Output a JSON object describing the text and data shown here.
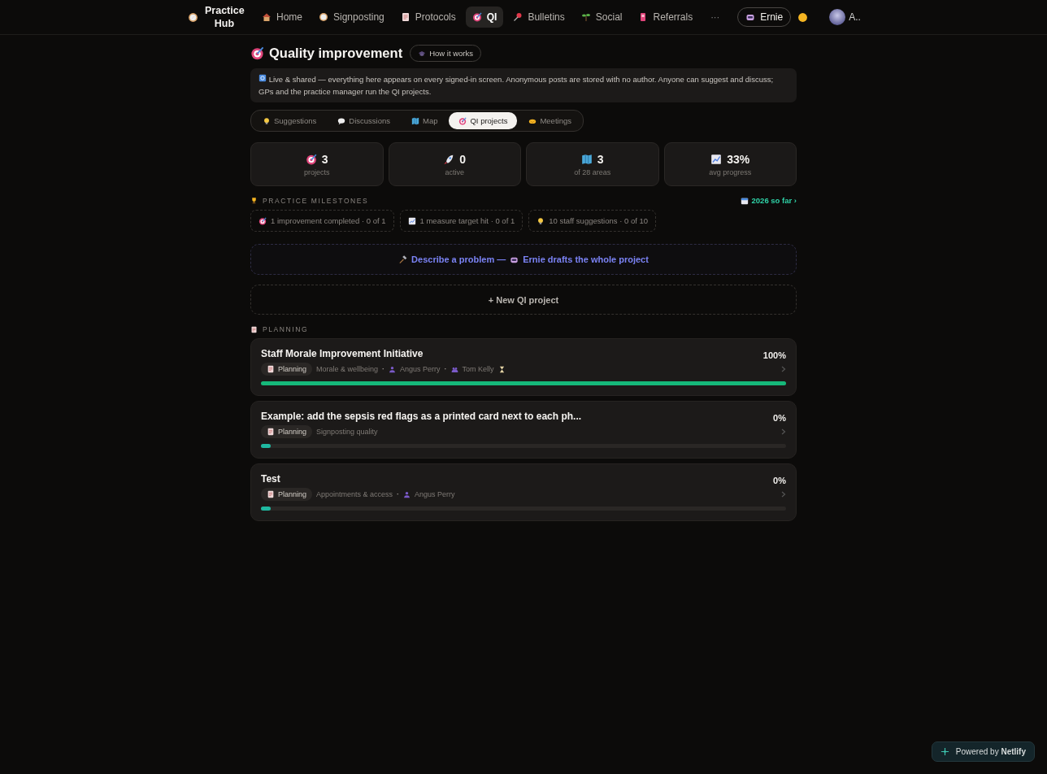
{
  "nav": {
    "brand": "Practice Hub",
    "items": [
      {
        "label": "Home",
        "selected": false
      },
      {
        "label": "Signposting",
        "selected": false
      },
      {
        "label": "Protocols",
        "selected": false
      },
      {
        "label": "QI",
        "selected": true
      },
      {
        "label": "Bulletins",
        "selected": false
      },
      {
        "label": "Social",
        "selected": false
      },
      {
        "label": "Referrals",
        "selected": false
      }
    ],
    "more": "···",
    "assistant": "Ernie",
    "user": "A.."
  },
  "header": {
    "title": "Quality improvement",
    "help_button": "How it works"
  },
  "notice": "Live & shared — everything here appears on every signed-in screen. Anonymous posts are stored with no author. Anyone can suggest and discuss; GPs and the practice manager run the QI projects.",
  "tabs": [
    {
      "label": "Suggestions",
      "selected": false
    },
    {
      "label": "Discussions",
      "selected": false
    },
    {
      "label": "Map",
      "selected": false
    },
    {
      "label": "QI projects",
      "selected": true
    },
    {
      "label": "Meetings",
      "selected": false
    }
  ],
  "stats": [
    {
      "value": "3",
      "label": "projects"
    },
    {
      "value": "0",
      "label": "active"
    },
    {
      "value": "3",
      "label": "of 28 areas"
    },
    {
      "value": "33%",
      "label": "avg progress"
    }
  ],
  "milestones": {
    "heading": "PRACTICE MILESTONES",
    "period_link": "2026 so far ›",
    "items": [
      "1 improvement completed · 0 of 1",
      "1 measure target hit · 0 of 1",
      "10 staff suggestions · 0 of 10"
    ]
  },
  "ai_prompt": {
    "left": "Describe a problem —",
    "right": "Ernie drafts the whole project"
  },
  "new_project": "+ New QI project",
  "meta_separator": "·",
  "section": {
    "heading": "PLANNING",
    "projects": [
      {
        "title": "Staff Morale Improvement Initiative",
        "percent": "100%",
        "level": 1,
        "status": "Planning",
        "area": "Morale & wellbeing",
        "lead": "Angus Perry",
        "team": "Tom Kelly",
        "pending": true
      },
      {
        "title": "Example: add the sepsis red flags as a printed card next to each ph...",
        "percent": "0%",
        "level": 0,
        "status": "Planning",
        "area": "Signposting quality",
        "pending": false
      },
      {
        "title": "Test",
        "percent": "0%",
        "level": 0,
        "status": "Planning",
        "area": "Appointments & access",
        "lead": "Angus Perry",
        "pending": false
      }
    ]
  },
  "badge": "Powered by **Netlify**"
}
